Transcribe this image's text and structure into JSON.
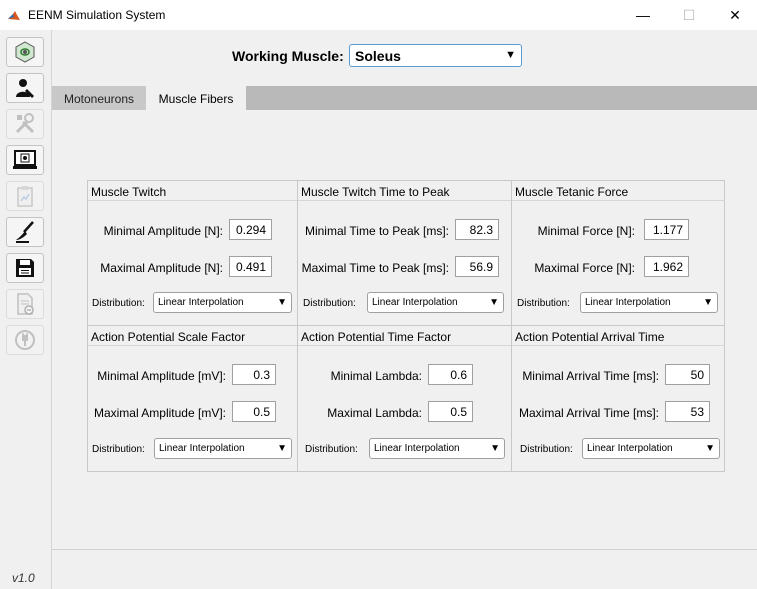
{
  "window": {
    "title": "EENM Simulation System",
    "minimize_glyph": "—",
    "maximize_glyph": "☐",
    "close_glyph": "✕"
  },
  "toolbar": {
    "buttons": [
      {
        "icon": "motor-unit-icon",
        "enabled": true
      },
      {
        "icon": "user-icon",
        "enabled": true
      },
      {
        "icon": "tools-icon",
        "enabled": false
      },
      {
        "icon": "monitor-icon",
        "enabled": true
      },
      {
        "icon": "clipboard-chart-icon",
        "enabled": false
      },
      {
        "icon": "broom-icon",
        "enabled": true
      },
      {
        "icon": "save-icon",
        "enabled": true
      },
      {
        "icon": "document-link-icon",
        "enabled": false
      },
      {
        "icon": "power-plug-icon",
        "enabled": false
      }
    ],
    "version": "v1.0"
  },
  "working_muscle": {
    "label": "Working Muscle:",
    "value": "Soleus"
  },
  "tabs": [
    {
      "label": "Motoneurons",
      "active": false
    },
    {
      "label": "Muscle Fibers",
      "active": true
    }
  ],
  "panels": [
    {
      "title": "Muscle Twitch",
      "min_label": "Minimal Amplitude [N]:",
      "min_value": "0.294",
      "max_label": "Maximal Amplitude [N]:",
      "max_value": "0.491",
      "dist_label": "Distribution:",
      "dist_value": "Linear Interpolation"
    },
    {
      "title": "Muscle Twitch Time to Peak",
      "min_label": "Minimal Time to Peak [ms]:",
      "min_value": "82.3",
      "max_label": "Maximal Time to Peak [ms]:",
      "max_value": "56.9",
      "dist_label": "Distribution:",
      "dist_value": "Linear Interpolation"
    },
    {
      "title": "Muscle Tetanic Force",
      "min_label": "Minimal Force [N]:",
      "min_value": "1.177",
      "max_label": "Maximal Force [N]:",
      "max_value": "1.962",
      "dist_label": "Distribution:",
      "dist_value": "Linear Interpolation"
    },
    {
      "title": "Action Potential Scale Factor",
      "min_label": "Minimal Amplitude [mV]:",
      "min_value": "0.3",
      "max_label": "Maximal Amplitude [mV]:",
      "max_value": "0.5",
      "dist_label": "Distribution:",
      "dist_value": "Linear Interpolation"
    },
    {
      "title": "Action Potential Time Factor",
      "min_label": "Minimal Lambda:",
      "min_value": "0.6",
      "max_label": "Maximal Lambda:",
      "max_value": "0.5",
      "dist_label": "Distribution:",
      "dist_value": "Linear Interpolation"
    },
    {
      "title": "Action Potential Arrival Time",
      "min_label": "Minimal Arrival Time [ms]:",
      "min_value": "50",
      "max_label": "Maximal Arrival Time [ms]:",
      "max_value": "53",
      "dist_label": "Distribution:",
      "dist_value": "Linear Interpolation"
    }
  ]
}
